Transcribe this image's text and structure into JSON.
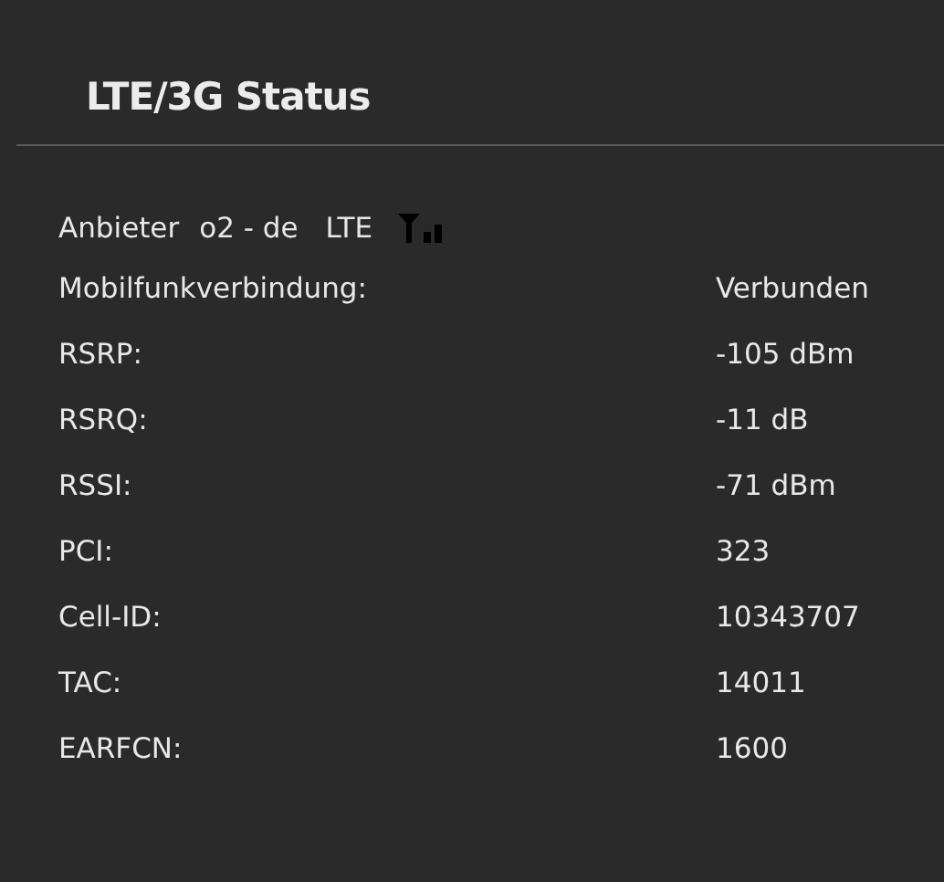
{
  "title": "LTE/3G Status",
  "provider": {
    "label": "Anbieter",
    "name": "o2 - de",
    "network": "LTE"
  },
  "rows": [
    {
      "label": "Mobilfunkverbindung:",
      "value": "Verbunden"
    },
    {
      "label": "RSRP:",
      "value": "-105 dBm"
    },
    {
      "label": "RSRQ:",
      "value": "-11 dB"
    },
    {
      "label": "RSSI:",
      "value": "-71 dBm"
    },
    {
      "label": "PCI:",
      "value": "323"
    },
    {
      "label": "Cell-ID:",
      "value": "10343707"
    },
    {
      "label": "TAC:",
      "value": "14011"
    },
    {
      "label": "EARFCN:",
      "value": "1600"
    }
  ]
}
